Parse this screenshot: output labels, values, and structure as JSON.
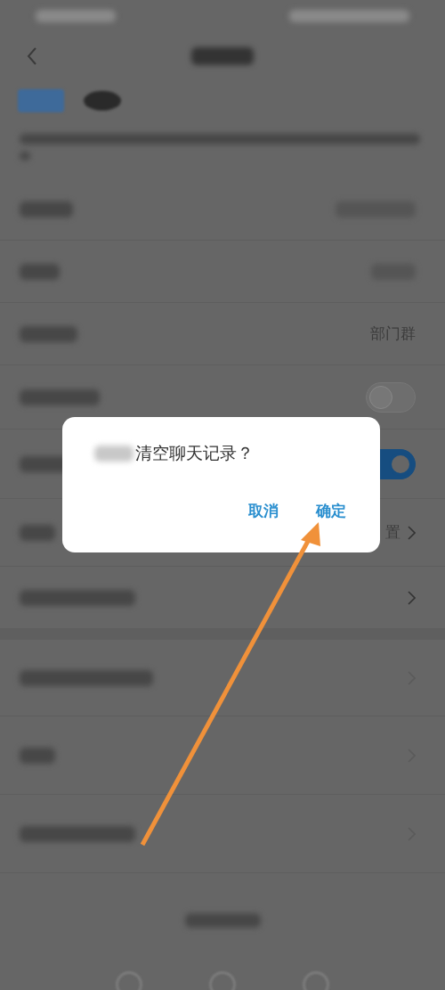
{
  "rows": [
    {
      "kind": "blurred_value"
    },
    {
      "kind": "blurred_value"
    },
    {
      "kind": "value",
      "value": "部门群"
    },
    {
      "kind": "toggle",
      "on": false
    },
    {
      "kind": "toggle",
      "on": true
    },
    {
      "kind": "link",
      "value": "置"
    },
    {
      "kind": "link"
    },
    {
      "kind": "link"
    },
    {
      "kind": "link"
    },
    {
      "kind": "link"
    }
  ],
  "dialog": {
    "message": "清空聊天记录？",
    "buttons": [
      {
        "label": "取消"
      },
      {
        "label": "确定"
      }
    ]
  }
}
